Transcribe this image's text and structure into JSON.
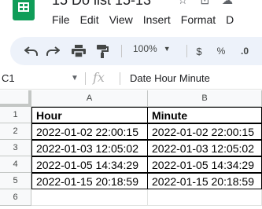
{
  "app": {
    "doc_title": "15 Do list 15-13",
    "title_icons": "☆ ⊡ ☁",
    "brand_color": "#0f9d58"
  },
  "menu": [
    "File",
    "Edit",
    "View",
    "Insert",
    "Format",
    "D"
  ],
  "toolbar": {
    "undo_icon": "undo-icon",
    "redo_icon": "redo-icon",
    "print_icon": "print-icon",
    "paint_format_icon": "paint-format-icon",
    "zoom_value": "100%",
    "currency": "$",
    "percent": "%",
    "decimal": ".0"
  },
  "formula_bar": {
    "cell_ref": "C1",
    "fx": "fx",
    "content": "Date Hour Minute"
  },
  "sheet": {
    "columns": [
      "A",
      "B"
    ],
    "rows": [
      "1",
      "2",
      "3",
      "4",
      "5",
      "6"
    ],
    "cells": [
      [
        "Hour",
        "Minute"
      ],
      [
        "2022-01-02 22:00:15",
        "2022-01-02 22:00:15"
      ],
      [
        "2022-01-03 12:05:02",
        "2022-01-03 12:05:02"
      ],
      [
        "2022-01-05 14:34:29",
        "2022-01-05 14:34:29"
      ],
      [
        "2022-01-15 20:18:59",
        "2022-01-15 20:18:59"
      ]
    ]
  }
}
